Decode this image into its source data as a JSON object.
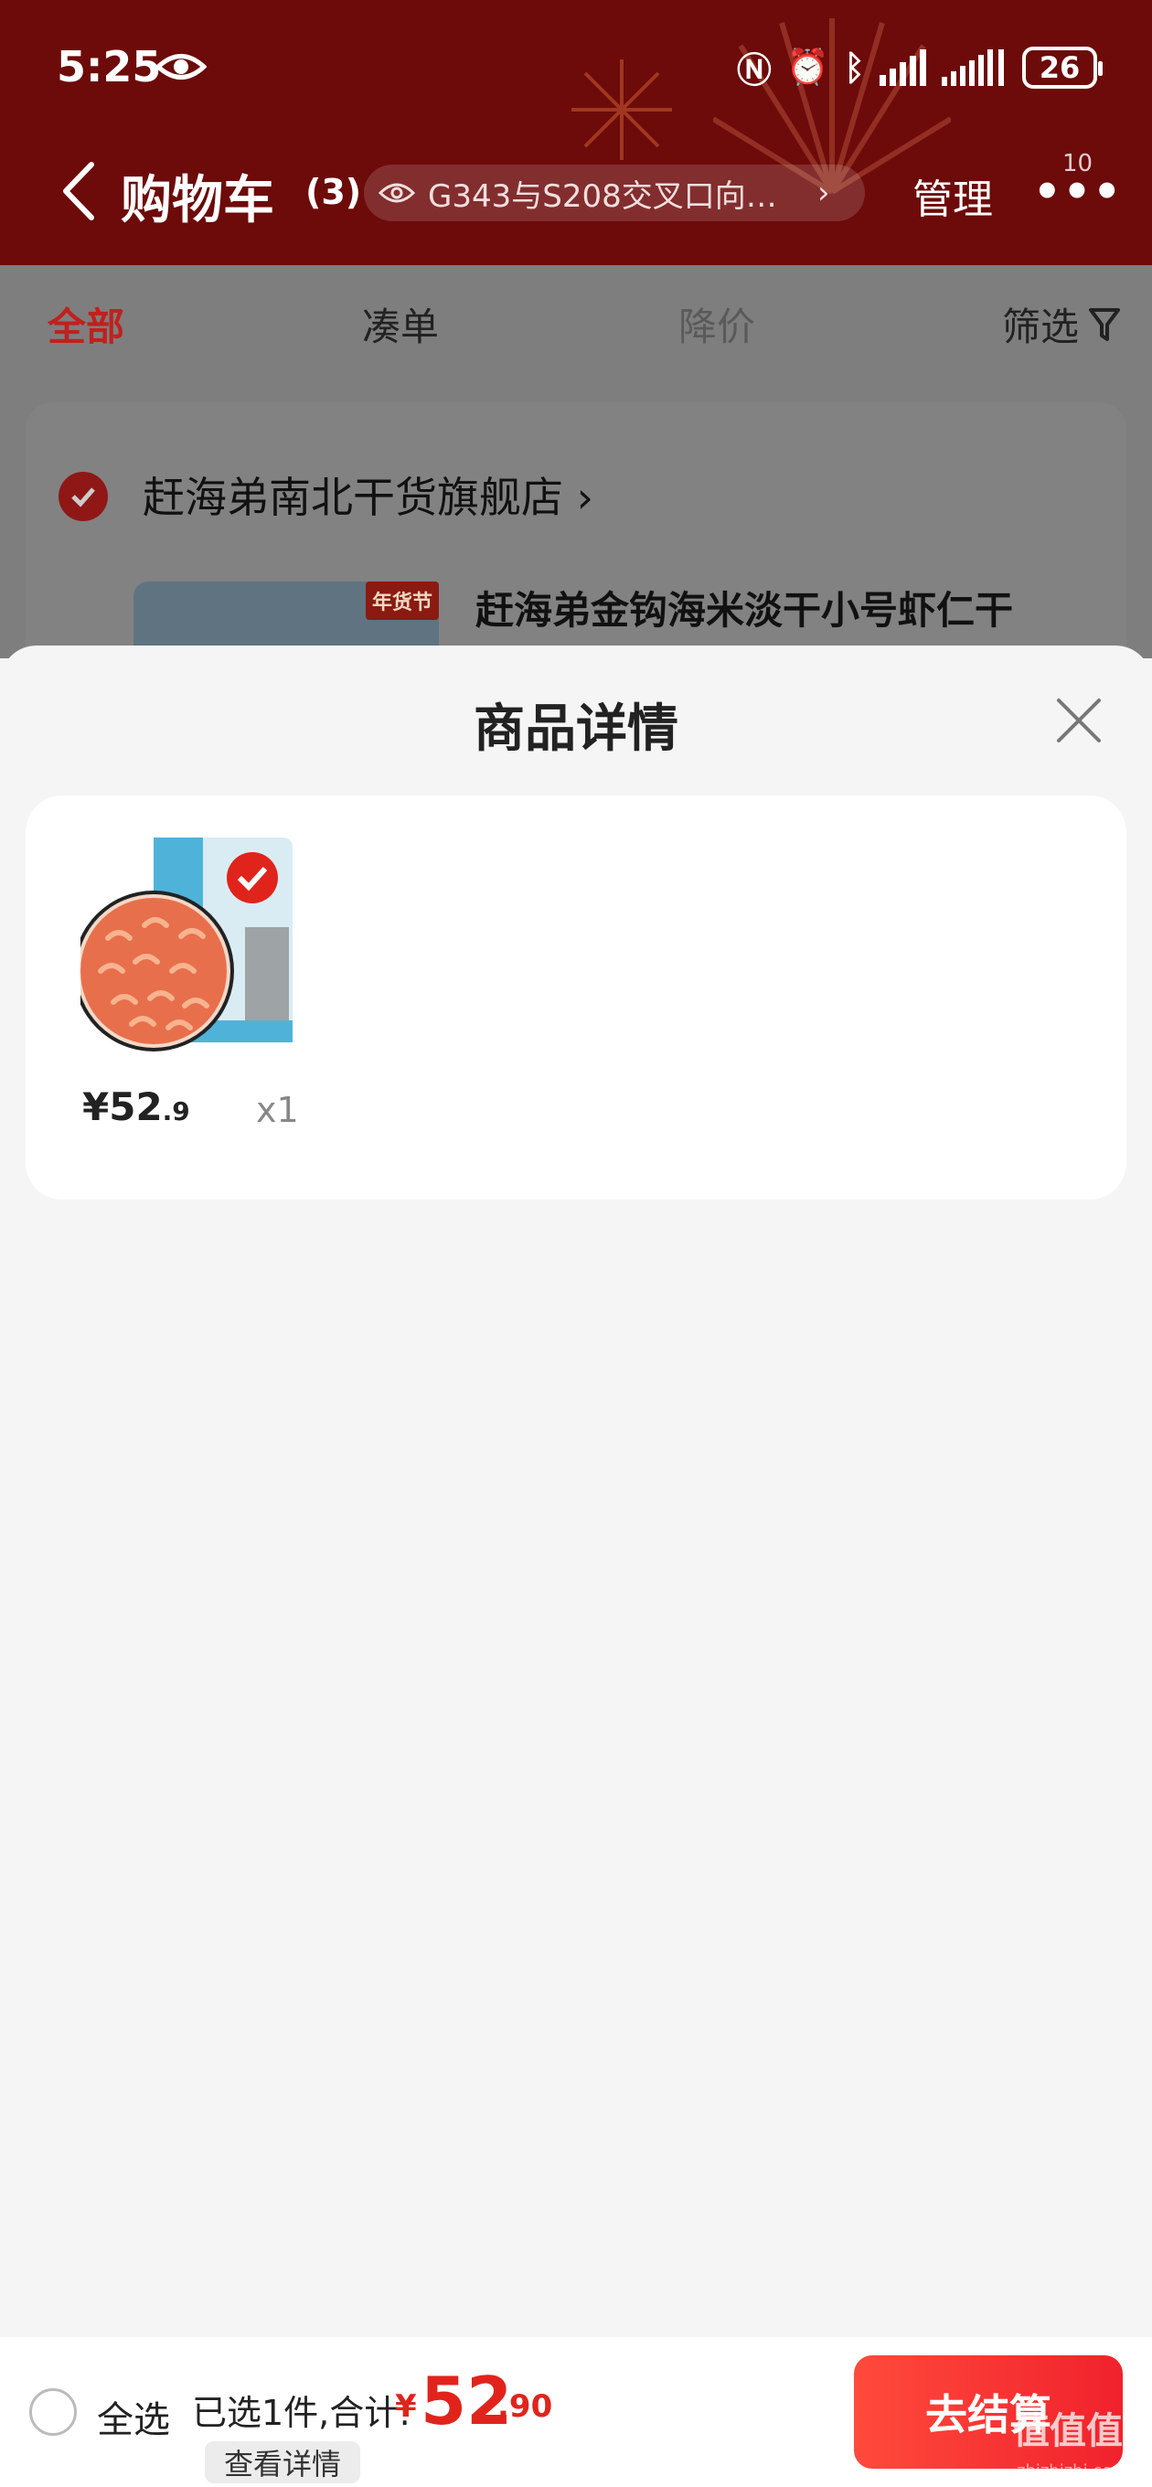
{
  "status_bar": {
    "time": "5:25",
    "battery": "26"
  },
  "header": {
    "title": "购物车",
    "count": "(3)",
    "location": "G343与S208交叉口向…",
    "manage_label": "管理",
    "more_badge": "10"
  },
  "tabs": [
    {
      "label": "全部"
    },
    {
      "label": "凑单"
    },
    {
      "label": "降价"
    }
  ],
  "filter_label": "筛选",
  "store": {
    "name": "赶海弟南北干货旗舰店",
    "tag": "年货节",
    "product_title": "赶海弟金钩海米淡干小号虾仁干"
  },
  "sheet": {
    "title": "商品详情",
    "item": {
      "price_int": "¥52",
      "price_dec": ".9",
      "qty": "x1"
    }
  },
  "bottom_bar": {
    "select_all": "全选",
    "selected_text": "已选1件,合计:",
    "currency": "¥",
    "total_int": "52",
    "total_dec": ".90",
    "detail_button": "查看详情",
    "checkout_button": "去结算"
  },
  "watermark": {
    "main": "值值值",
    "sub": "zhizhizhi.com"
  },
  "colors": {
    "header_bg": "#6d0a0a",
    "accent_red": "#e0241c",
    "active_tab": "#c1201d"
  }
}
